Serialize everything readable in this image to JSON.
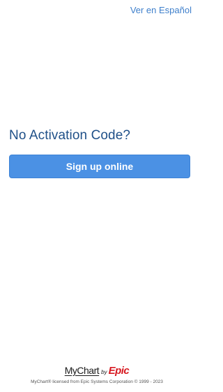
{
  "language_link": "Ver en Español",
  "main": {
    "heading": "No Activation Code?",
    "signup_button": "Sign up online"
  },
  "footer": {
    "logo": {
      "mychart": "MyChart",
      "by": "by",
      "epic": "Epic"
    },
    "copyright": "MyChart® licensed from Epic Systems Corporation © 1999 - 2023"
  },
  "colors": {
    "link": "#3e7fcb",
    "heading": "#1f5088",
    "button": "#4b91e4",
    "epic_red": "#d71920"
  }
}
